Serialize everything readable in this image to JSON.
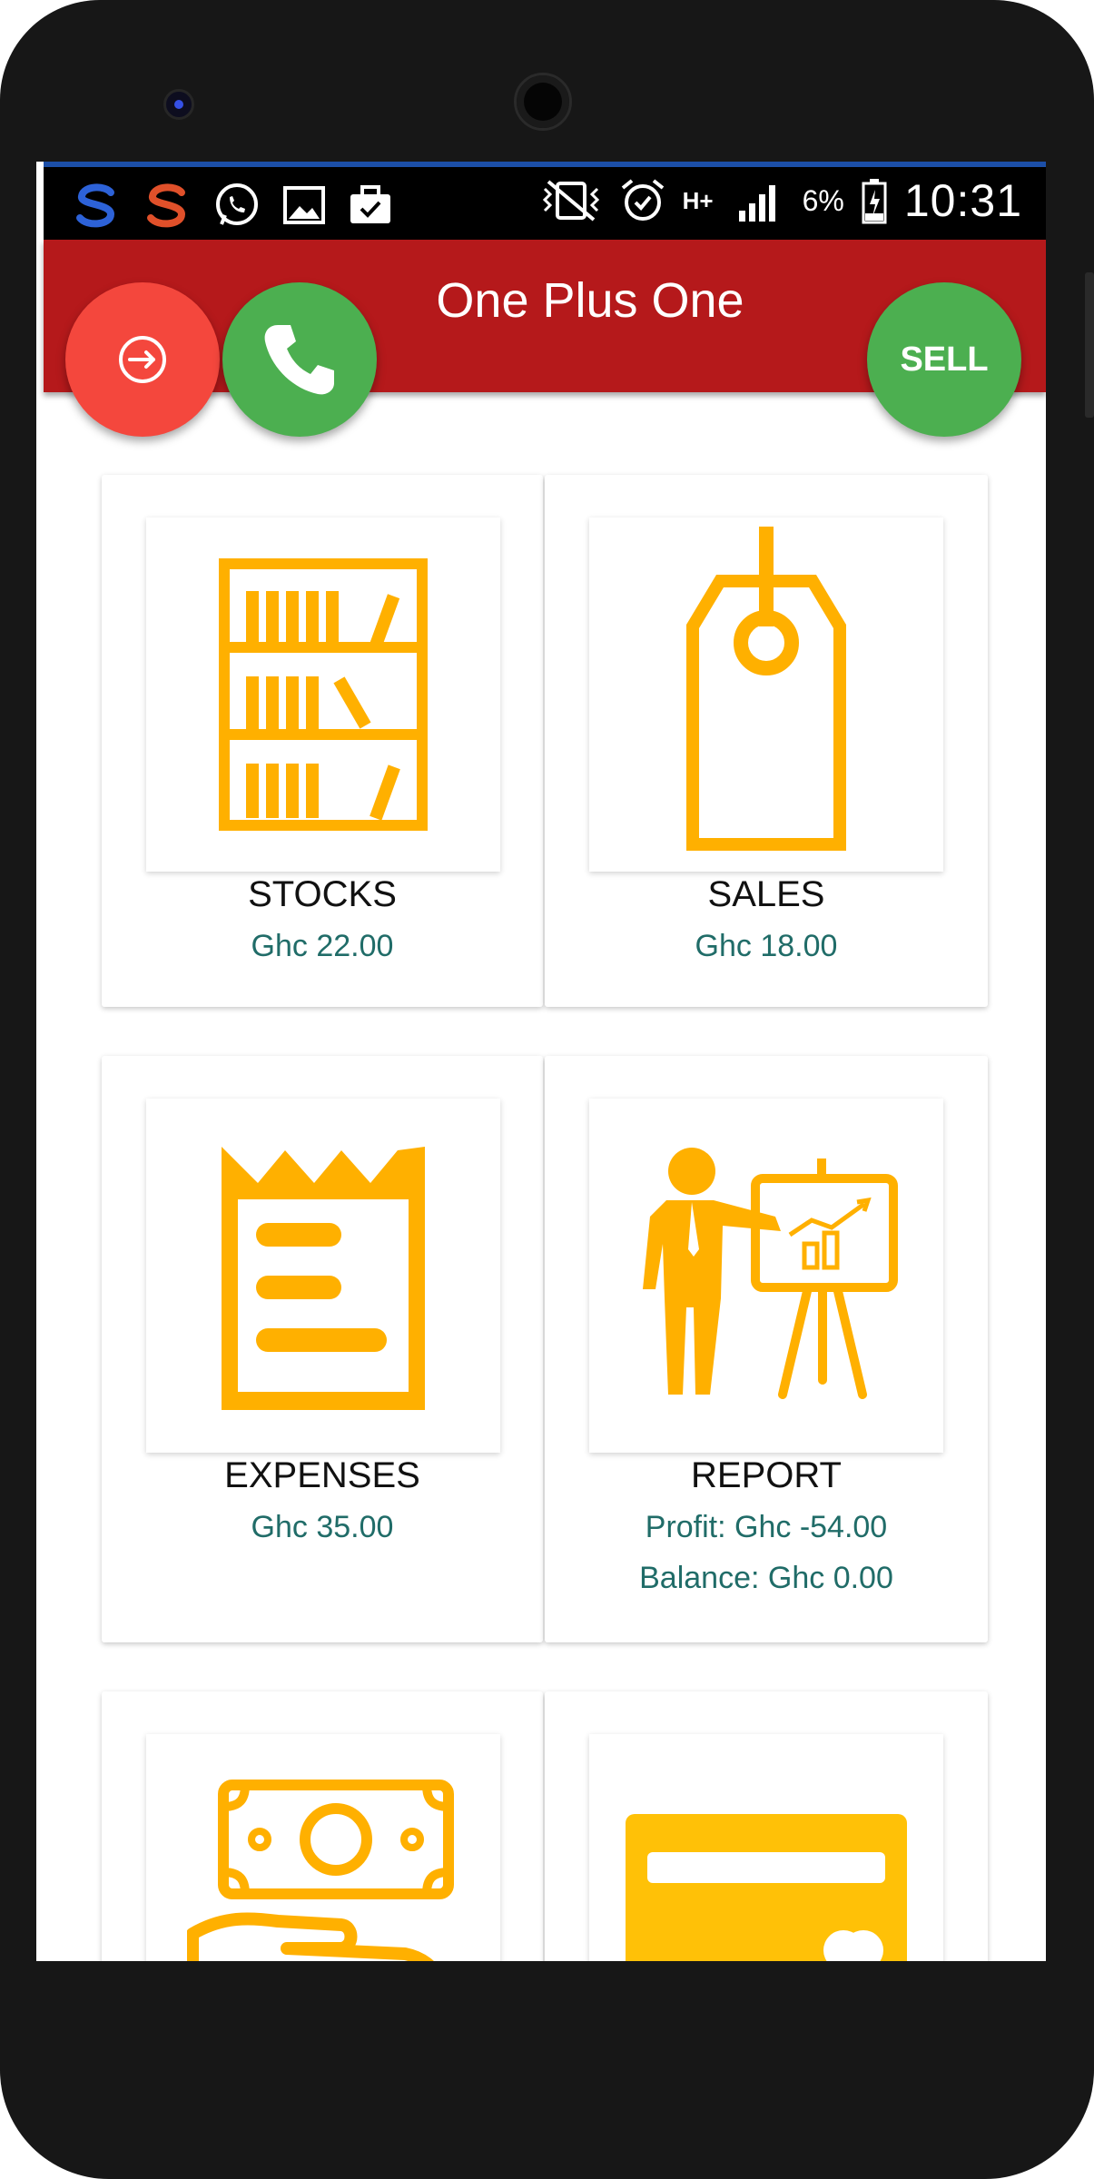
{
  "status_bar": {
    "time": "10:31",
    "battery_percent": "6%",
    "network": "H+",
    "left_icons": [
      "app-s-blue-icon",
      "app-s-orange-icon",
      "whatsapp-icon",
      "gallery-icon",
      "briefcase-icon"
    ],
    "right_icons": [
      "vibrate-mute-icon",
      "alarm-icon",
      "network-type-icon",
      "signal-icon",
      "battery-icon"
    ]
  },
  "app_bar": {
    "title": "One Plus One",
    "sell_label": "SELL"
  },
  "cards": [
    {
      "id": "stocks",
      "title": "STOCKS",
      "value": "Ghc 22.00",
      "icon": "bookshelf-icon"
    },
    {
      "id": "sales",
      "title": "SALES",
      "value": "Ghc 18.00",
      "icon": "price-tag-icon"
    },
    {
      "id": "expenses",
      "title": "EXPENSES",
      "value": "Ghc 35.00",
      "icon": "receipt-icon"
    },
    {
      "id": "report",
      "title": "REPORT",
      "profit": "Profit: Ghc -54.00",
      "balance": "Balance: Ghc 0.00",
      "icon": "presentation-icon"
    },
    {
      "id": "payment",
      "icon": "cash-hand-icon"
    },
    {
      "id": "card",
      "icon": "credit-card-icon"
    }
  ],
  "colors": {
    "app_bar": "#b5191b",
    "icon": "#ffb000",
    "value_text": "#206c68",
    "fab_logout": "#f4473d",
    "fab_green": "#4caf50"
  }
}
